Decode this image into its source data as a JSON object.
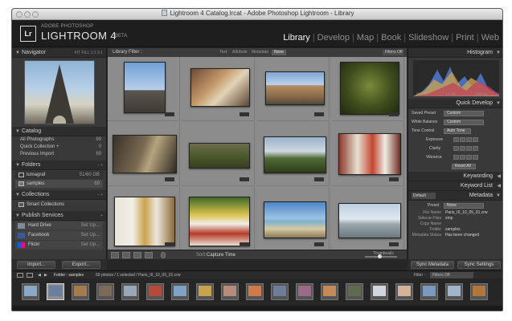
{
  "window": {
    "title": "Lightroom 4 Catalog.lrcat - Adobe Photoshop Lightroom - Library"
  },
  "identity_plate": {
    "badge": "Lr",
    "adobe": "ADOBE PHOTOSHOP",
    "product": "LIGHTROOM 4",
    "beta": "BETA"
  },
  "modules": [
    "Library",
    "Develop",
    "Map",
    "Book",
    "Slideshow",
    "Print",
    "Web"
  ],
  "active_module": "Library",
  "left_panel": {
    "navigator": {
      "label": "Navigator",
      "options": "FIT  FILL  1:1  3:1"
    },
    "catalog": {
      "label": "Catalog",
      "items": [
        {
          "label": "All Photographs",
          "count": "69"
        },
        {
          "label": "Quick Collection +",
          "count": "0"
        },
        {
          "label": "Previous Import",
          "count": "69"
        }
      ]
    },
    "folders": {
      "label": "Folders",
      "volume": {
        "label": "lumagraf",
        "count": "51/60 GB"
      },
      "items": [
        {
          "label": "samples",
          "count": "69"
        }
      ]
    },
    "collections": {
      "label": "Collections",
      "items": [
        {
          "label": "Smart Collections"
        }
      ]
    },
    "publish_services": {
      "label": "Publish Services",
      "items": [
        {
          "label": "Hard Drive",
          "action": "Set Up..."
        },
        {
          "label": "Facebook",
          "action": "Set Up..."
        },
        {
          "label": "Flickr",
          "action": "Set Up..."
        }
      ]
    },
    "import_label": "Import...",
    "export_label": "Export..."
  },
  "filter_bar": {
    "title": "Library Filter :",
    "tabs": [
      "Text",
      "Attribute",
      "Metadata",
      "None"
    ],
    "active_tab": "None",
    "filters": "Filters Off"
  },
  "grid": {
    "numbers": [
      "",
      "",
      "",
      "",
      "",
      "",
      "",
      "",
      "",
      "",
      "",
      ""
    ]
  },
  "toolbar": {
    "sort_label": "Sort:",
    "sort_value": "Capture Time",
    "thumbnails_label": "Thumbnails"
  },
  "right_panel": {
    "histogram": {
      "label": "Histogram",
      "readout": [
        "ISO 12",
        "1.1 mm",
        "1/400 sec"
      ]
    },
    "quick_develop": {
      "label": "Quick Develop",
      "saved_preset_label": "Saved Preset",
      "saved_preset_value": "Custom",
      "white_balance_label": "White Balance",
      "white_balance_value": "Custom",
      "tone_control_label": "Tone Control",
      "auto_tone": "Auto Tone",
      "sliders": [
        "Exposure",
        "Clarity",
        "Vibrance"
      ],
      "reset_all": "Reset All"
    },
    "keywording": {
      "label": "Keywording"
    },
    "keyword_list": {
      "label": "Keyword List"
    },
    "metadata": {
      "label": "Metadata",
      "preset_select": "Default",
      "preset_label": "Preset",
      "preset_value": "None",
      "fields": [
        {
          "key": "File Name",
          "value": "Paris_III_10_05_01.crw"
        },
        {
          "key": "Sidecar Files",
          "value": "xmp"
        },
        {
          "key": "Copy Name",
          "value": ""
        },
        {
          "key": "Folder",
          "value": "samples"
        },
        {
          "key": "Metadata Status",
          "value": "Has been changed"
        }
      ]
    },
    "sync_metadata": "Sync Metadata",
    "sync_settings": "Sync Settings"
  },
  "filmstrip": {
    "breadcrumb": "Folder : samples",
    "selection": "69 photos / 1 selected / Paris_III_10_05_01.crw",
    "filter_label": "Filter :",
    "filter_value": "Filters Off",
    "thumb_count": 19
  },
  "colors": {
    "panel_bg": "#393939",
    "grid_bg": "#8b8b8b",
    "active_module": "#f4f4f4"
  }
}
